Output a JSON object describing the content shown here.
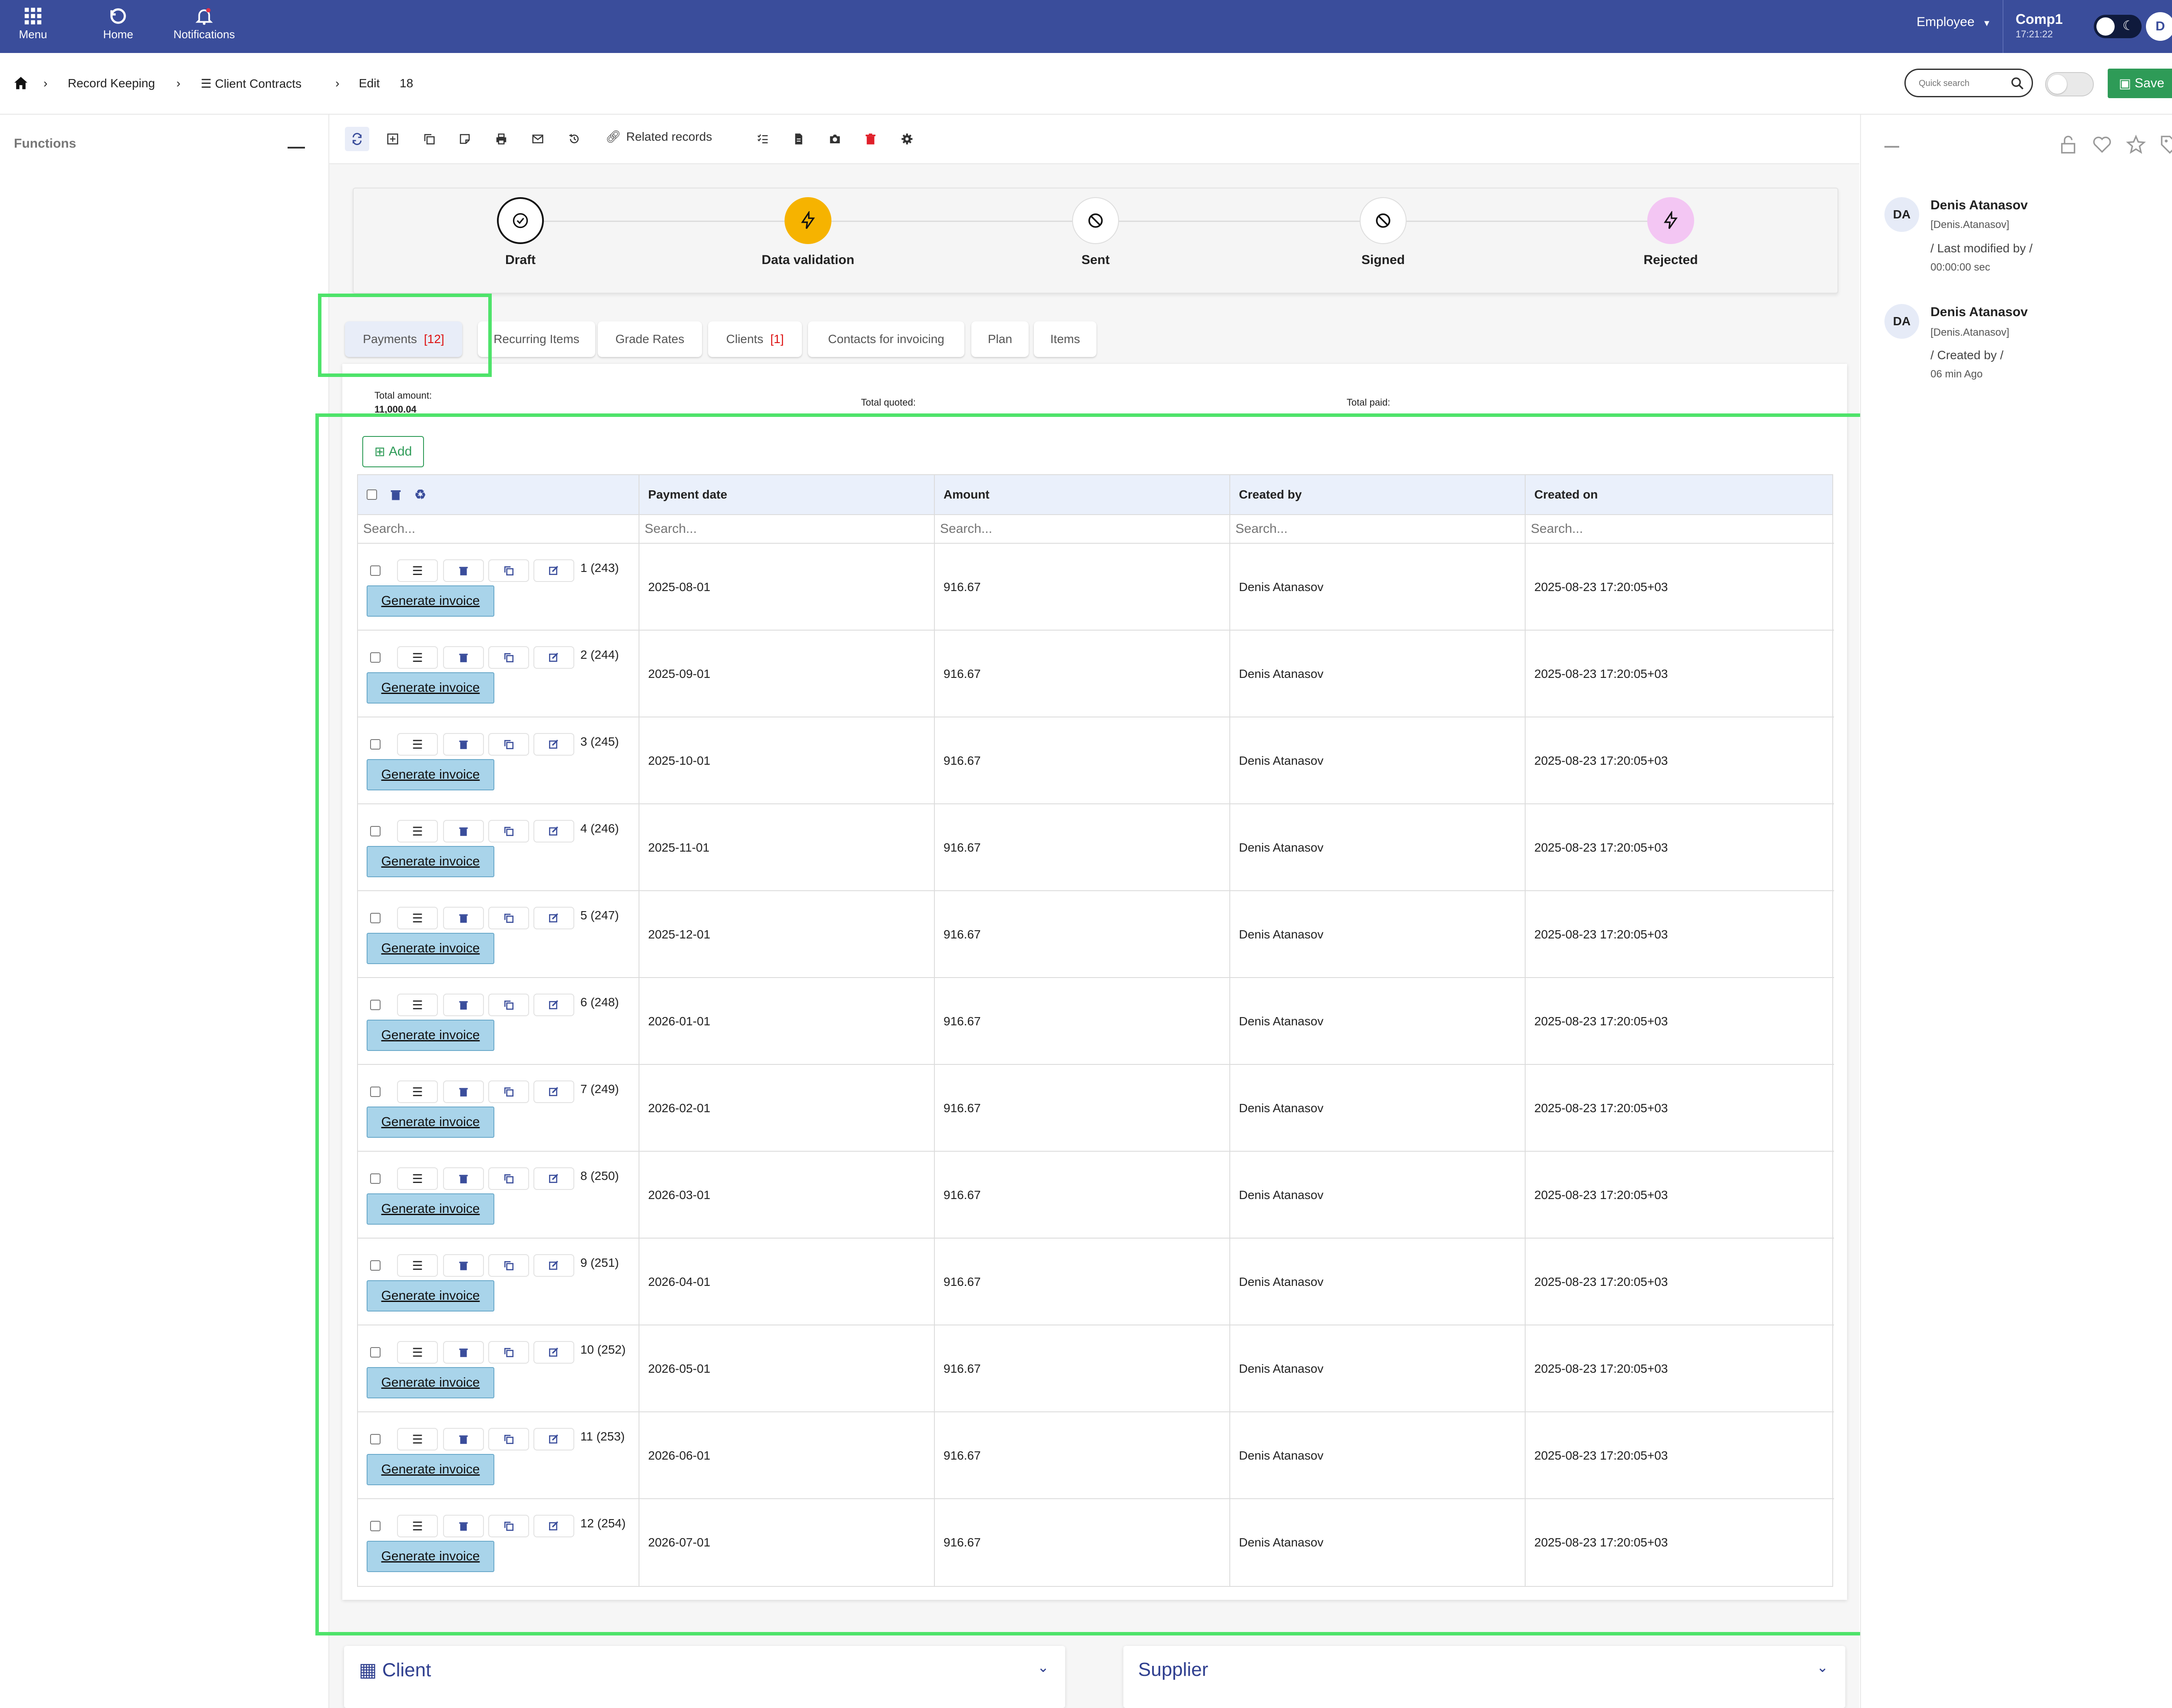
{
  "topbar": {
    "menu_label": "Menu",
    "home_label": "Home",
    "notifications_label": "Notifications",
    "role": "Employee",
    "company": "Comp1",
    "time": "17:21:22",
    "avatar_letter": "D",
    "bg_color": "#3a4d9b"
  },
  "breadcrumb": {
    "item1": "Record Keeping",
    "item2": "Client Contracts",
    "item3": "Edit",
    "record_id": "18",
    "search_placeholder": "Quick search",
    "save_label": "Save"
  },
  "sidebar": {
    "title": "Functions"
  },
  "toolbar": {
    "related_records_label": "Related records"
  },
  "steps": [
    {
      "label": "Draft",
      "state": "current"
    },
    {
      "label": "Data validation",
      "state": "pending"
    },
    {
      "label": "Sent",
      "state": "blocked"
    },
    {
      "label": "Signed",
      "state": "blocked"
    },
    {
      "label": "Rejected",
      "state": "pending"
    }
  ],
  "tabs": [
    {
      "label": "Payments",
      "count": "[12]"
    },
    {
      "label": "Recurring Items",
      "count": ""
    },
    {
      "label": "Grade Rates",
      "count": ""
    },
    {
      "label": "Clients",
      "count": "[1]"
    },
    {
      "label": "Contacts for invoicing",
      "count": ""
    },
    {
      "label": "Plan",
      "count": ""
    },
    {
      "label": "Items",
      "count": ""
    }
  ],
  "totals": {
    "amount_label": "Total amount:",
    "amount_value": "11,000.04",
    "quoted_label": "Total quoted:",
    "paid_label": "Total paid:"
  },
  "grid": {
    "add_label": "Add",
    "columns": [
      "Payment date",
      "Amount",
      "Created by",
      "Created on"
    ],
    "search_placeholder": "Search...",
    "generate_label": "Generate invoice",
    "rows": [
      {
        "id": "1 (243)",
        "date": "2025-08-01",
        "amount": "916.67",
        "created_by": "Denis Atanasov",
        "created_on": "2025-08-23 17:20:05+03"
      },
      {
        "id": "2 (244)",
        "date": "2025-09-01",
        "amount": "916.67",
        "created_by": "Denis Atanasov",
        "created_on": "2025-08-23 17:20:05+03"
      },
      {
        "id": "3 (245)",
        "date": "2025-10-01",
        "amount": "916.67",
        "created_by": "Denis Atanasov",
        "created_on": "2025-08-23 17:20:05+03"
      },
      {
        "id": "4 (246)",
        "date": "2025-11-01",
        "amount": "916.67",
        "created_by": "Denis Atanasov",
        "created_on": "2025-08-23 17:20:05+03"
      },
      {
        "id": "5 (247)",
        "date": "2025-12-01",
        "amount": "916.67",
        "created_by": "Denis Atanasov",
        "created_on": "2025-08-23 17:20:05+03"
      },
      {
        "id": "6 (248)",
        "date": "2026-01-01",
        "amount": "916.67",
        "created_by": "Denis Atanasov",
        "created_on": "2025-08-23 17:20:05+03"
      },
      {
        "id": "7 (249)",
        "date": "2026-02-01",
        "amount": "916.67",
        "created_by": "Denis Atanasov",
        "created_on": "2025-08-23 17:20:05+03"
      },
      {
        "id": "8 (250)",
        "date": "2026-03-01",
        "amount": "916.67",
        "created_by": "Denis Atanasov",
        "created_on": "2025-08-23 17:20:05+03"
      },
      {
        "id": "9 (251)",
        "date": "2026-04-01",
        "amount": "916.67",
        "created_by": "Denis Atanasov",
        "created_on": "2025-08-23 17:20:05+03"
      },
      {
        "id": "10 (252)",
        "date": "2026-05-01",
        "amount": "916.67",
        "created_by": "Denis Atanasov",
        "created_on": "2025-08-23 17:20:05+03"
      },
      {
        "id": "11 (253)",
        "date": "2026-06-01",
        "amount": "916.67",
        "created_by": "Denis Atanasov",
        "created_on": "2025-08-23 17:20:05+03"
      },
      {
        "id": "12 (254)",
        "date": "2026-07-01",
        "amount": "916.67",
        "created_by": "Denis Atanasov",
        "created_on": "2025-08-23 17:20:05+03"
      }
    ]
  },
  "history": [
    {
      "initials": "DA",
      "name": "Denis Atanasov",
      "username": "[Denis.Atanasov]",
      "action": "/ Last modified by /",
      "when": "00:00:00 sec"
    },
    {
      "initials": "DA",
      "name": "Denis Atanasov",
      "username": "[Denis.Atanasov]",
      "action": "/ Created by /",
      "when": "06 min Ago"
    }
  ],
  "bottom": {
    "client_title": "Client",
    "supplier_title": "Supplier"
  },
  "colors": {
    "highlight": "#4ee36a",
    "save": "#2e9b57",
    "accent": "#3a4d9b",
    "badge_red": "#d11111"
  }
}
